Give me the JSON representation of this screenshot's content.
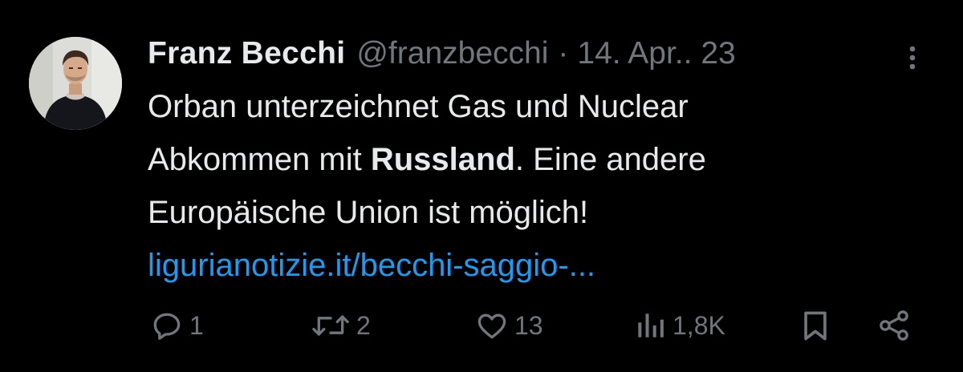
{
  "tweet": {
    "author_name": "Franz Becchi",
    "handle": "@franzbecchi",
    "separator": "·",
    "date": "14. Apr.. 23",
    "text_part1": "Orban unterzeichnet Gas und Nuclear",
    "text_part2_prefix": "Abkommen mit ",
    "text_bold": "Russland",
    "text_part2_suffix": ". Eine andere",
    "text_part3": "Europäische Union ist möglich!",
    "link": "ligurianotizie.it/becchi-saggio-..."
  },
  "actions": {
    "replies": "1",
    "retweets": "2",
    "likes": "13",
    "views": "1,8K"
  },
  "icons": {
    "more": "more-vertical-icon",
    "reply": "reply-icon",
    "retweet": "retweet-icon",
    "like": "heart-icon",
    "views": "views-icon",
    "bookmark": "bookmark-icon",
    "share": "share-icon"
  },
  "colors": {
    "background": "#000000",
    "text": "#e7e9ea",
    "muted": "#71767b",
    "link": "#1d9bf0"
  }
}
